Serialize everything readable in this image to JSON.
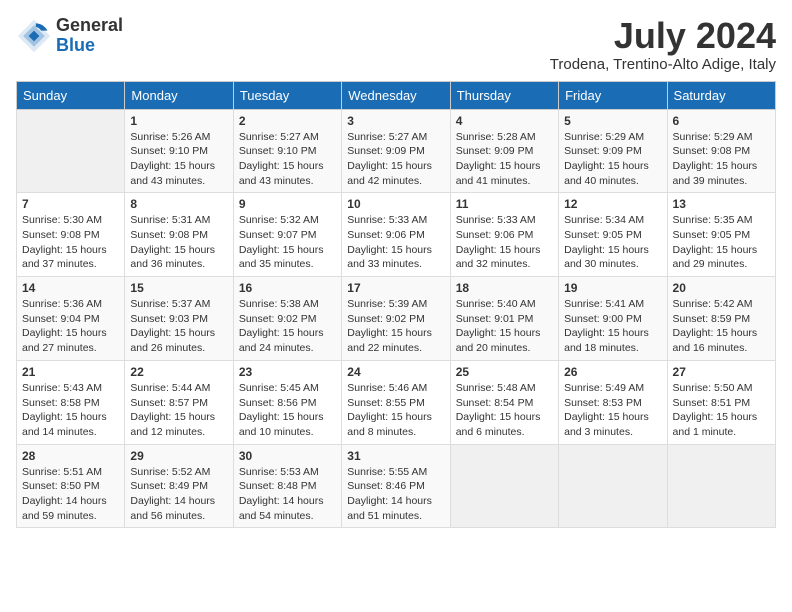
{
  "header": {
    "logo_general": "General",
    "logo_blue": "Blue",
    "month_year": "July 2024",
    "location": "Trodena, Trentino-Alto Adige, Italy"
  },
  "calendar": {
    "days_of_week": [
      "Sunday",
      "Monday",
      "Tuesday",
      "Wednesday",
      "Thursday",
      "Friday",
      "Saturday"
    ],
    "weeks": [
      [
        {
          "day": "",
          "info": ""
        },
        {
          "day": "1",
          "info": "Sunrise: 5:26 AM\nSunset: 9:10 PM\nDaylight: 15 hours\nand 43 minutes."
        },
        {
          "day": "2",
          "info": "Sunrise: 5:27 AM\nSunset: 9:10 PM\nDaylight: 15 hours\nand 43 minutes."
        },
        {
          "day": "3",
          "info": "Sunrise: 5:27 AM\nSunset: 9:09 PM\nDaylight: 15 hours\nand 42 minutes."
        },
        {
          "day": "4",
          "info": "Sunrise: 5:28 AM\nSunset: 9:09 PM\nDaylight: 15 hours\nand 41 minutes."
        },
        {
          "day": "5",
          "info": "Sunrise: 5:29 AM\nSunset: 9:09 PM\nDaylight: 15 hours\nand 40 minutes."
        },
        {
          "day": "6",
          "info": "Sunrise: 5:29 AM\nSunset: 9:08 PM\nDaylight: 15 hours\nand 39 minutes."
        }
      ],
      [
        {
          "day": "7",
          "info": "Sunrise: 5:30 AM\nSunset: 9:08 PM\nDaylight: 15 hours\nand 37 minutes."
        },
        {
          "day": "8",
          "info": "Sunrise: 5:31 AM\nSunset: 9:08 PM\nDaylight: 15 hours\nand 36 minutes."
        },
        {
          "day": "9",
          "info": "Sunrise: 5:32 AM\nSunset: 9:07 PM\nDaylight: 15 hours\nand 35 minutes."
        },
        {
          "day": "10",
          "info": "Sunrise: 5:33 AM\nSunset: 9:06 PM\nDaylight: 15 hours\nand 33 minutes."
        },
        {
          "day": "11",
          "info": "Sunrise: 5:33 AM\nSunset: 9:06 PM\nDaylight: 15 hours\nand 32 minutes."
        },
        {
          "day": "12",
          "info": "Sunrise: 5:34 AM\nSunset: 9:05 PM\nDaylight: 15 hours\nand 30 minutes."
        },
        {
          "day": "13",
          "info": "Sunrise: 5:35 AM\nSunset: 9:05 PM\nDaylight: 15 hours\nand 29 minutes."
        }
      ],
      [
        {
          "day": "14",
          "info": "Sunrise: 5:36 AM\nSunset: 9:04 PM\nDaylight: 15 hours\nand 27 minutes."
        },
        {
          "day": "15",
          "info": "Sunrise: 5:37 AM\nSunset: 9:03 PM\nDaylight: 15 hours\nand 26 minutes."
        },
        {
          "day": "16",
          "info": "Sunrise: 5:38 AM\nSunset: 9:02 PM\nDaylight: 15 hours\nand 24 minutes."
        },
        {
          "day": "17",
          "info": "Sunrise: 5:39 AM\nSunset: 9:02 PM\nDaylight: 15 hours\nand 22 minutes."
        },
        {
          "day": "18",
          "info": "Sunrise: 5:40 AM\nSunset: 9:01 PM\nDaylight: 15 hours\nand 20 minutes."
        },
        {
          "day": "19",
          "info": "Sunrise: 5:41 AM\nSunset: 9:00 PM\nDaylight: 15 hours\nand 18 minutes."
        },
        {
          "day": "20",
          "info": "Sunrise: 5:42 AM\nSunset: 8:59 PM\nDaylight: 15 hours\nand 16 minutes."
        }
      ],
      [
        {
          "day": "21",
          "info": "Sunrise: 5:43 AM\nSunset: 8:58 PM\nDaylight: 15 hours\nand 14 minutes."
        },
        {
          "day": "22",
          "info": "Sunrise: 5:44 AM\nSunset: 8:57 PM\nDaylight: 15 hours\nand 12 minutes."
        },
        {
          "day": "23",
          "info": "Sunrise: 5:45 AM\nSunset: 8:56 PM\nDaylight: 15 hours\nand 10 minutes."
        },
        {
          "day": "24",
          "info": "Sunrise: 5:46 AM\nSunset: 8:55 PM\nDaylight: 15 hours\nand 8 minutes."
        },
        {
          "day": "25",
          "info": "Sunrise: 5:48 AM\nSunset: 8:54 PM\nDaylight: 15 hours\nand 6 minutes."
        },
        {
          "day": "26",
          "info": "Sunrise: 5:49 AM\nSunset: 8:53 PM\nDaylight: 15 hours\nand 3 minutes."
        },
        {
          "day": "27",
          "info": "Sunrise: 5:50 AM\nSunset: 8:51 PM\nDaylight: 15 hours\nand 1 minute."
        }
      ],
      [
        {
          "day": "28",
          "info": "Sunrise: 5:51 AM\nSunset: 8:50 PM\nDaylight: 14 hours\nand 59 minutes."
        },
        {
          "day": "29",
          "info": "Sunrise: 5:52 AM\nSunset: 8:49 PM\nDaylight: 14 hours\nand 56 minutes."
        },
        {
          "day": "30",
          "info": "Sunrise: 5:53 AM\nSunset: 8:48 PM\nDaylight: 14 hours\nand 54 minutes."
        },
        {
          "day": "31",
          "info": "Sunrise: 5:55 AM\nSunset: 8:46 PM\nDaylight: 14 hours\nand 51 minutes."
        },
        {
          "day": "",
          "info": ""
        },
        {
          "day": "",
          "info": ""
        },
        {
          "day": "",
          "info": ""
        }
      ]
    ]
  }
}
